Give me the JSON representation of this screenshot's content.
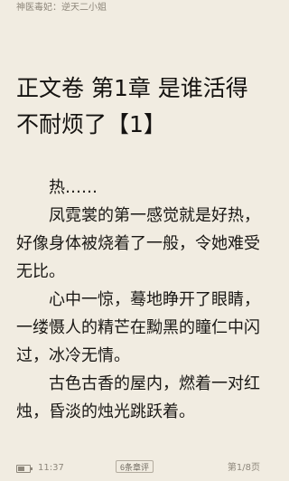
{
  "header": {
    "book_title": "神医毒妃：逆天二小姐"
  },
  "chapter": {
    "title": "正文卷 第1章 是谁活得不耐烦了【1】"
  },
  "content": {
    "paragraphs": [
      "热……",
      "凤霓裳的第一感觉就是好热，好像身体被烧着了一般，令她难受无比。",
      "心中一惊，蓦地睁开了眼睛，一缕慑人的精芒在黝黑的瞳仁中闪过，冰冷无情。",
      "古色古香的屋内，燃着一对红烛，昏淡的烛光跳跃着。"
    ]
  },
  "footer": {
    "battery_icon": "battery-icon",
    "battery_level": 0.6,
    "time": "11:37",
    "comments_label": "6条章评",
    "page": "第1/8页"
  }
}
